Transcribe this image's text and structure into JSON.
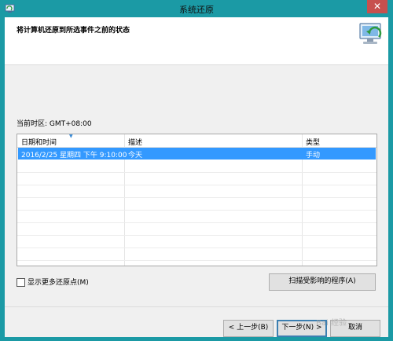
{
  "window": {
    "title": "系统还原",
    "close_glyph": "✕"
  },
  "header": {
    "title": "将计算机还原到所选事件之前的状态"
  },
  "timezone_label": "当前时区: GMT+08:00",
  "table": {
    "columns": [
      "日期和时间",
      "描述",
      "类型"
    ],
    "rows": [
      {
        "datetime": "2016/2/25 星期四 下午 9:10:00",
        "description": "今天",
        "type": "手动",
        "selected": true
      }
    ]
  },
  "show_more_label": "显示更多还原点(M)",
  "buttons": {
    "scan": "扫描受影响的程序(A)",
    "back": "< 上一步(B)",
    "next": "下一步(N) >",
    "cancel": "取消"
  },
  "watermark": "Bai 经验",
  "colors": {
    "titlebar": "#1b9aa5",
    "selection": "#3399ff",
    "close": "#c7504e"
  }
}
